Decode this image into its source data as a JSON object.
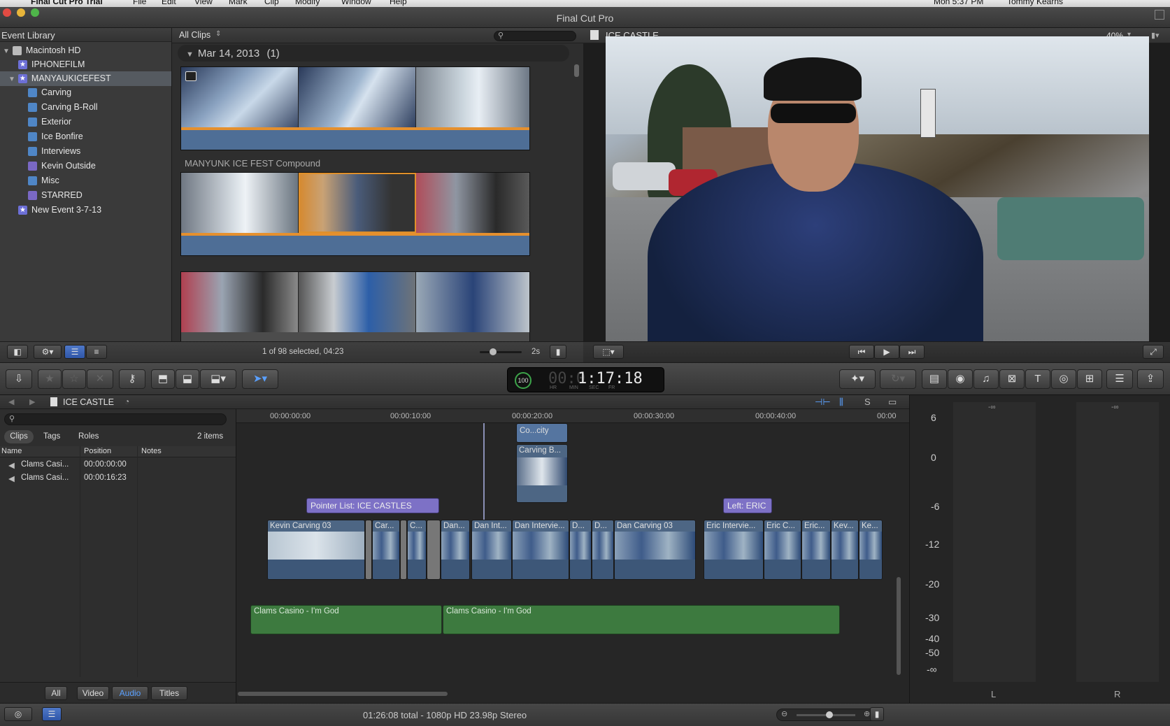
{
  "menu": {
    "app": "Final Cut Pro Trial",
    "items": [
      "File",
      "Edit",
      "View",
      "Mark",
      "Clip",
      "Modify",
      "Window",
      "Help"
    ],
    "clock": "Mon 5:37 PM",
    "user": "Tommy Kearns"
  },
  "window": {
    "title": "Final Cut Pro"
  },
  "library": {
    "header": "Event Library",
    "items": [
      {
        "label": "Macintosh HD",
        "type": "drive"
      },
      {
        "label": "IPHONEFILM",
        "type": "event"
      },
      {
        "label": "MANYAUKICEFEST",
        "type": "event",
        "selected": true
      },
      {
        "label": "Carving",
        "type": "keyword"
      },
      {
        "label": "Carving B-Roll",
        "type": "keyword"
      },
      {
        "label": "Exterior",
        "type": "keyword"
      },
      {
        "label": "Ice Bonfire",
        "type": "keyword"
      },
      {
        "label": "Interviews",
        "type": "keyword"
      },
      {
        "label": "Kevin Outside",
        "type": "smart"
      },
      {
        "label": "Misc",
        "type": "keyword"
      },
      {
        "label": "STARRED",
        "type": "smart"
      },
      {
        "label": "New Event 3-7-13",
        "type": "event"
      }
    ]
  },
  "browser": {
    "filter": "All Clips",
    "date_group": "Mar 14, 2013",
    "date_count": "(1)",
    "compound_label": "MANYUNK ICE FEST Compound",
    "selection_status": "1 of 98 selected, 04:23",
    "duration_setting": "2s"
  },
  "viewer": {
    "title": "ICE CASTLE",
    "zoom": "40%"
  },
  "toolbar": {
    "timecode": "1:17:18",
    "timecode_prefix": "00:0",
    "timecode_units": [
      "HR",
      "MIN",
      "SEC",
      "FR"
    ],
    "speed": "100"
  },
  "timeline": {
    "project": "ICE CASTLE",
    "ruler": [
      "00:00:00:00",
      "00:00:10:00",
      "00:00:20:00",
      "00:00:30:00",
      "00:00:40:00",
      "00:00"
    ],
    "markers": [
      "Pointer List: ICE CASTLES",
      "Left: ERIC"
    ],
    "connected": [
      "Co...city",
      "Carving B..."
    ],
    "clips": [
      "Kevin Carving 03",
      "Car...",
      "C...",
      "Dan...",
      "Dan Int...",
      "Dan Intervie...",
      "D...",
      "D...",
      "Dan Carving 03",
      "Eric Intervie...",
      "Eric C...",
      "Eric...",
      "Kev...",
      "Ke..."
    ],
    "music": [
      "Clams Casino - I'm God",
      "Clams Casino - I'm God"
    ]
  },
  "timeline_index": {
    "tabs": [
      "Clips",
      "Tags",
      "Roles"
    ],
    "count": "2 items",
    "columns": [
      "Name",
      "Position",
      "Notes"
    ],
    "rows": [
      {
        "name": "Clams Casi...",
        "position": "00:00:00:00"
      },
      {
        "name": "Clams Casi...",
        "position": "00:00:16:23"
      }
    ],
    "filters": [
      "All",
      "Video",
      "Audio",
      "Titles"
    ],
    "active_filter": "Audio"
  },
  "meters": {
    "scale": [
      "6",
      "0",
      "-6",
      "-12",
      "-20",
      "-30",
      "-40",
      "-50",
      "-∞"
    ],
    "peak_left": "-∞",
    "peak_right": "-∞",
    "channels": [
      "L",
      "R"
    ]
  },
  "status": {
    "summary": "01:26:08 total - 1080p HD 23.98p Stereo"
  },
  "colors": {
    "clip_blue": "#4d6684",
    "music_green": "#3d7a3f",
    "marker_purple": "#7d71c6",
    "selection": "#555a60"
  }
}
